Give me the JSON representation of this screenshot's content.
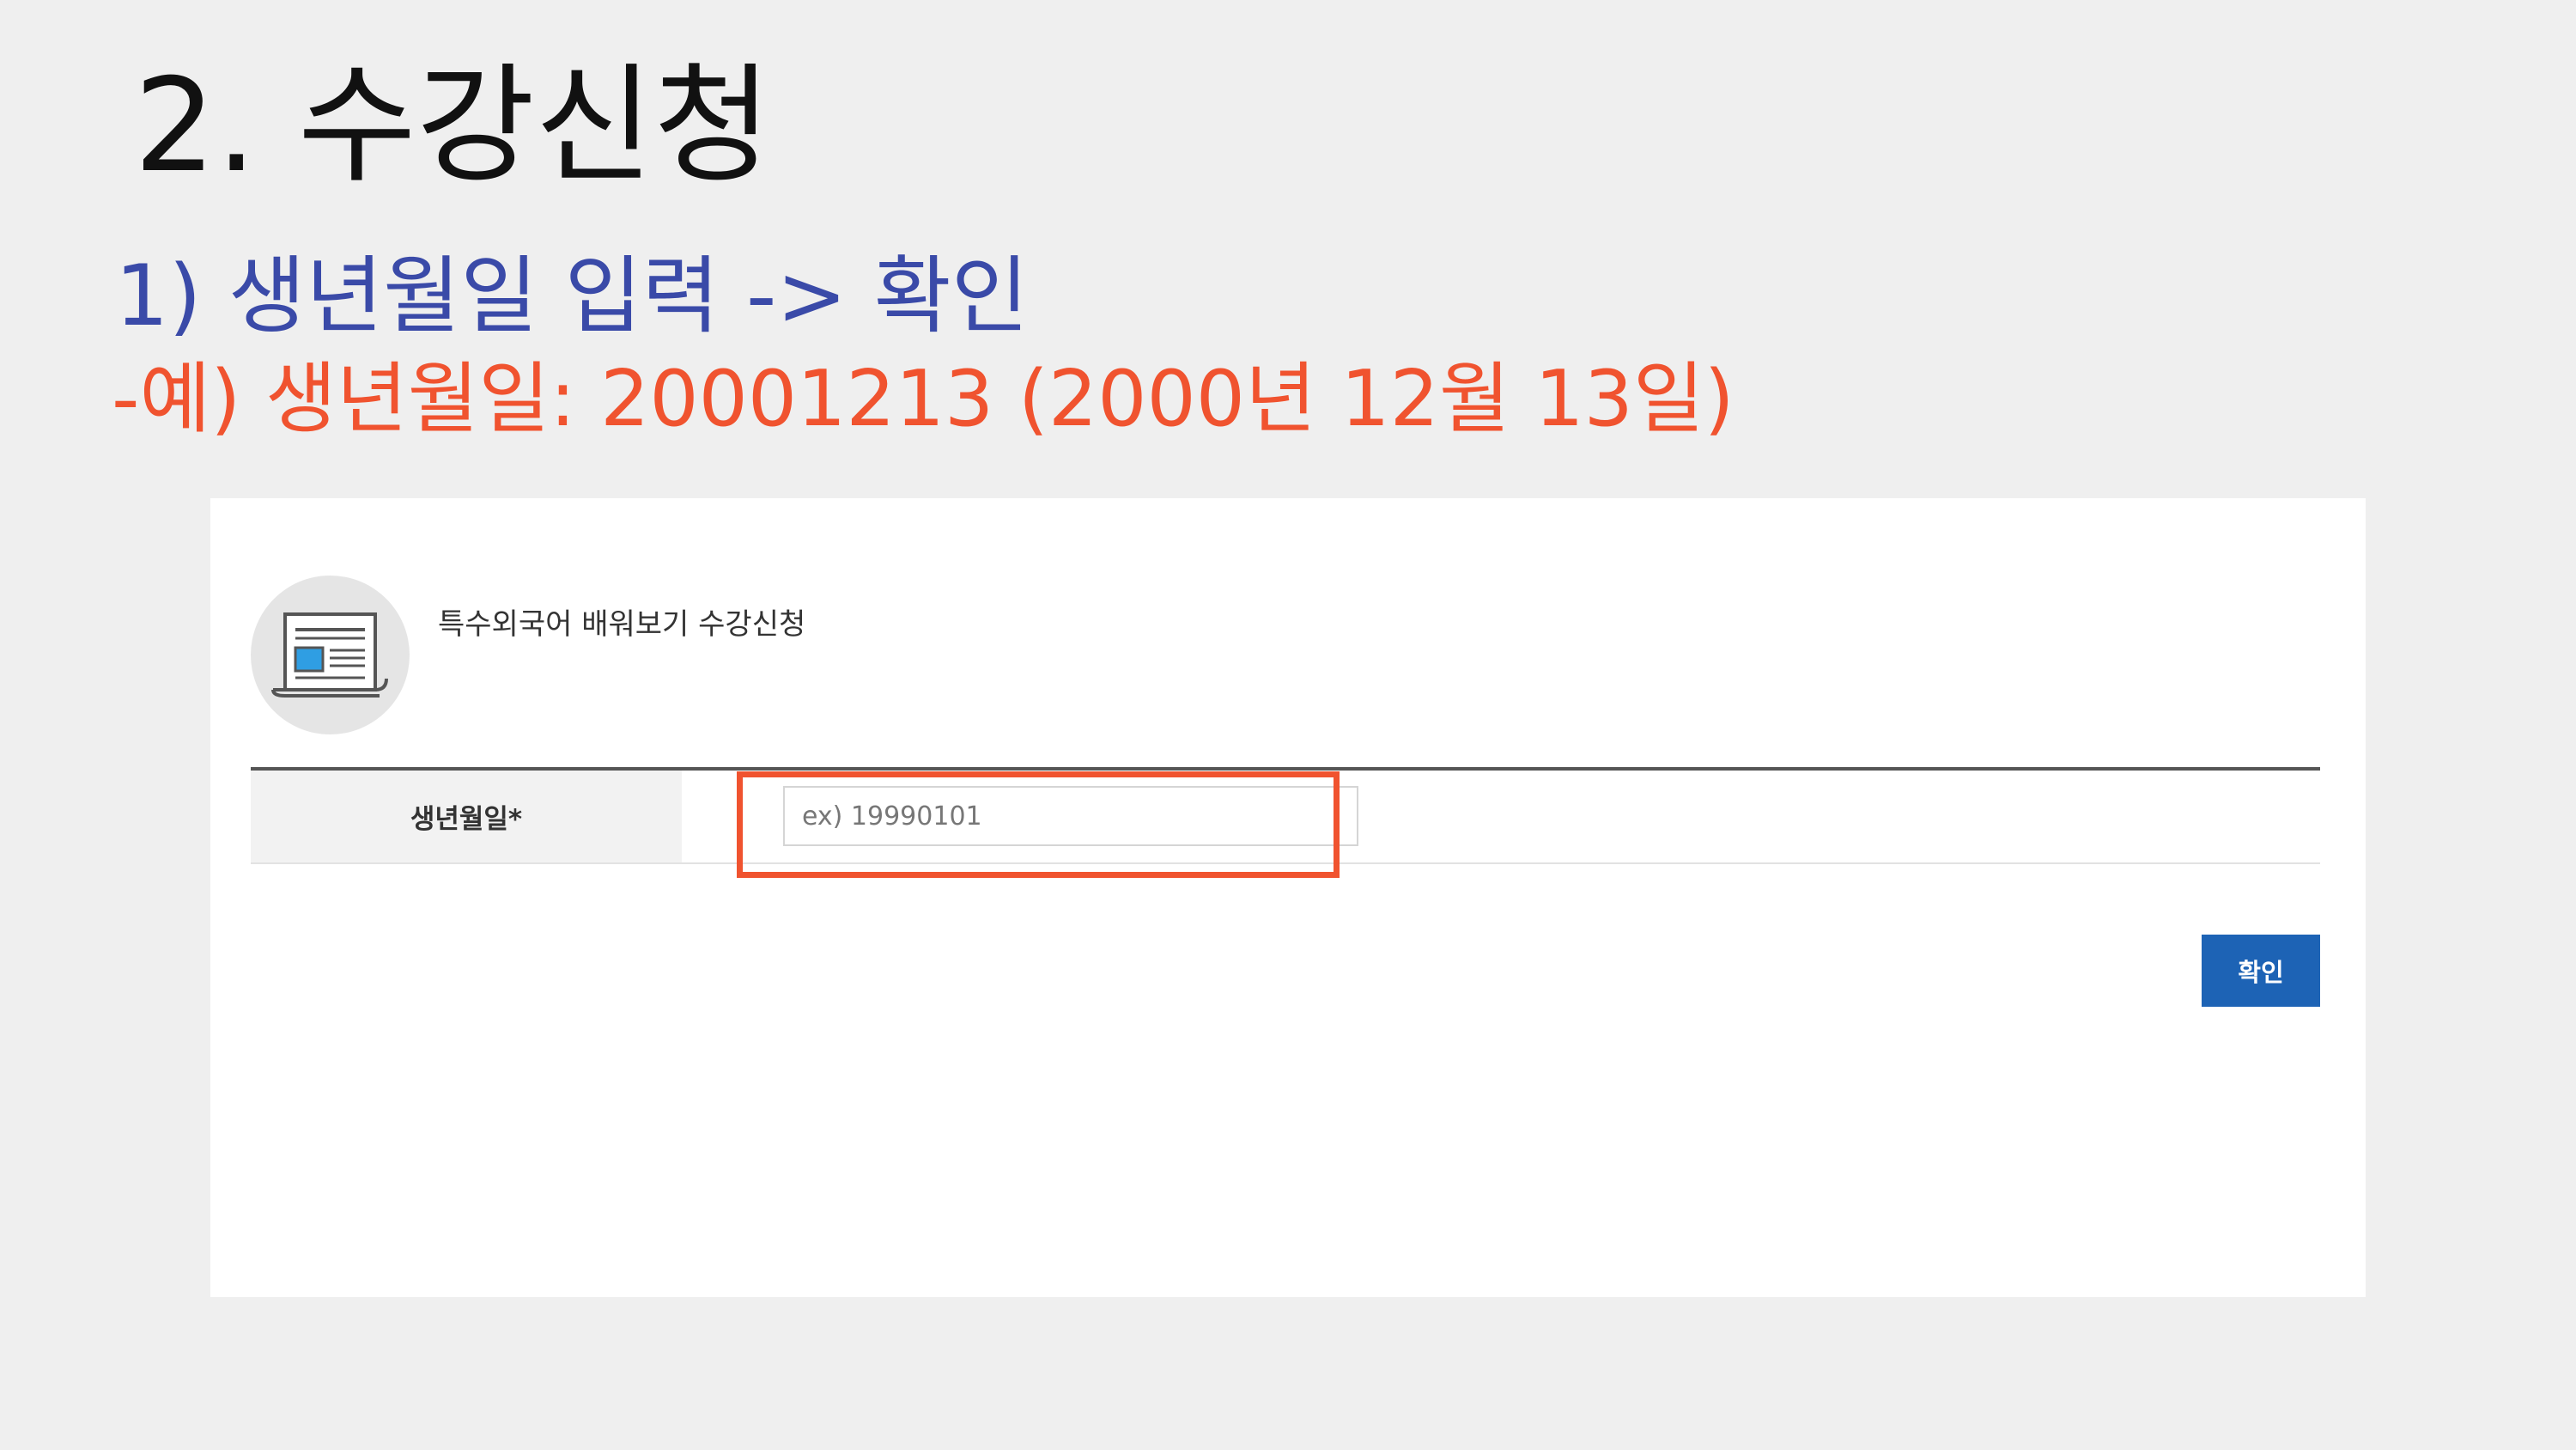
{
  "slide": {
    "title": "2. 수강신청",
    "step": "1) 생년월일 입력 -> 확인",
    "example": "-예) 생년월일: 20001213 (2000년 12월 13일)"
  },
  "panel": {
    "title": "특수외국어 배워보기 수강신청",
    "icon": "document-icon",
    "form": {
      "birth_label": "생년월일*",
      "birth_placeholder": "ex) 19990101",
      "birth_value": ""
    },
    "confirm_label": "확인"
  },
  "colors": {
    "step_text": "#3a4aa8",
    "example_text": "#f0532f",
    "highlight": "#f0532f",
    "button": "#1d63b5"
  }
}
